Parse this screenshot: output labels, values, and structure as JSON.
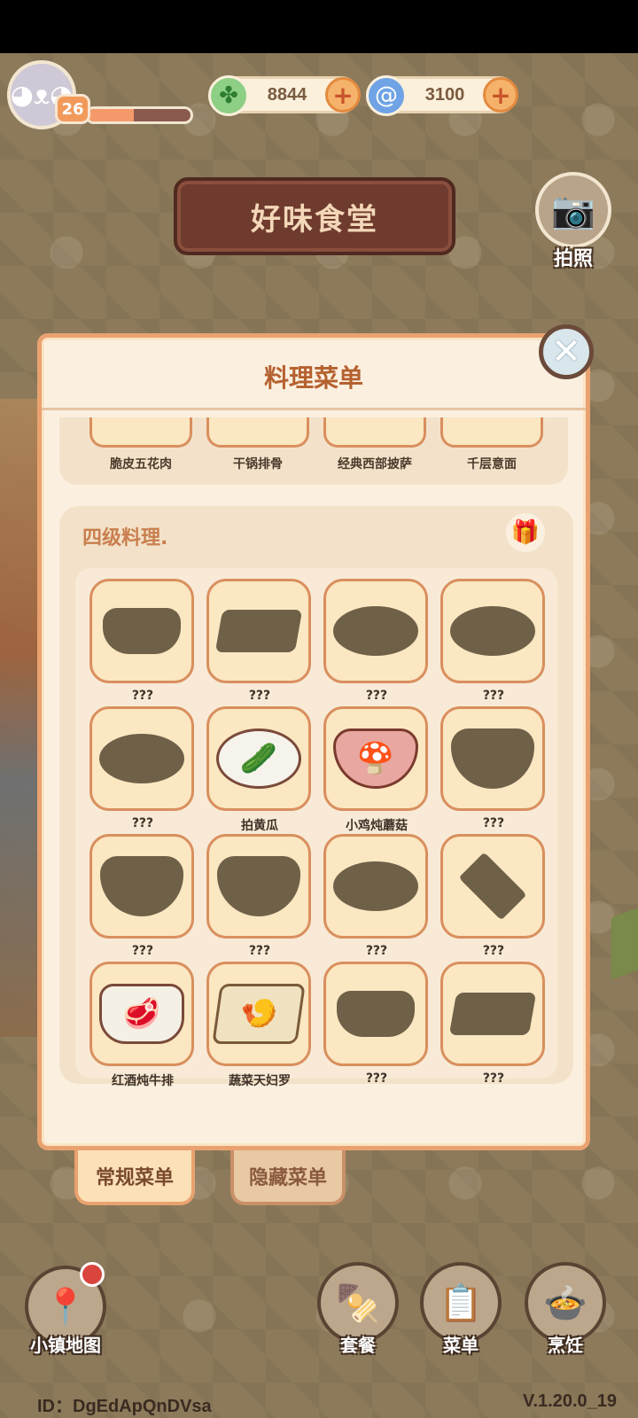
{
  "hud": {
    "level": "26",
    "xp_progress": 0.45,
    "currencies": [
      {
        "icon": "clover-icon",
        "value": "8844"
      },
      {
        "icon": "spiral-icon",
        "value": "3100"
      }
    ]
  },
  "sign": {
    "title": "好味食堂"
  },
  "camera": {
    "label": "拍照"
  },
  "dialog": {
    "title": "料理菜单",
    "tier3_dishes": [
      "脆皮五花肉",
      "干锅排骨",
      "经典西部披萨",
      "千层意面"
    ],
    "tier4": {
      "title": "四级料理.",
      "dishes": [
        {
          "name": "???",
          "icon": "locked-dish-icon"
        },
        {
          "name": "???",
          "icon": "locked-dish-icon"
        },
        {
          "name": "???",
          "icon": "locked-dish-icon"
        },
        {
          "name": "???",
          "icon": "locked-dish-icon"
        },
        {
          "name": "???",
          "icon": "locked-dish-icon"
        },
        {
          "name": "拍黄瓜",
          "icon": "smashed-cucumber-icon"
        },
        {
          "name": "小鸡炖蘑菇",
          "icon": "chicken-mushroom-stew-icon"
        },
        {
          "name": "???",
          "icon": "locked-dish-icon"
        },
        {
          "name": "???",
          "icon": "locked-dish-icon"
        },
        {
          "name": "???",
          "icon": "locked-dish-icon"
        },
        {
          "name": "???",
          "icon": "locked-dish-icon"
        },
        {
          "name": "???",
          "icon": "locked-dish-icon"
        },
        {
          "name": "红酒炖牛排",
          "icon": "red-wine-beef-stew-icon"
        },
        {
          "name": "蔬菜天妇罗",
          "icon": "vegetable-tempura-icon"
        },
        {
          "name": "???",
          "icon": "locked-dish-icon"
        },
        {
          "name": "???",
          "icon": "locked-dish-icon"
        }
      ]
    }
  },
  "tabs": {
    "regular": "常规菜单",
    "hidden": "隐藏菜单"
  },
  "bottom": {
    "map": "小镇地图",
    "combo": "套餐",
    "menu": "菜单",
    "cook": "烹饪"
  },
  "footer": {
    "id": "ID：DgEdApQnDVsa",
    "version": "V.1.20.0_19"
  },
  "colors": {
    "accent": "#e9a26f",
    "title": "#b5612f",
    "panel": "#fbf0e0"
  }
}
